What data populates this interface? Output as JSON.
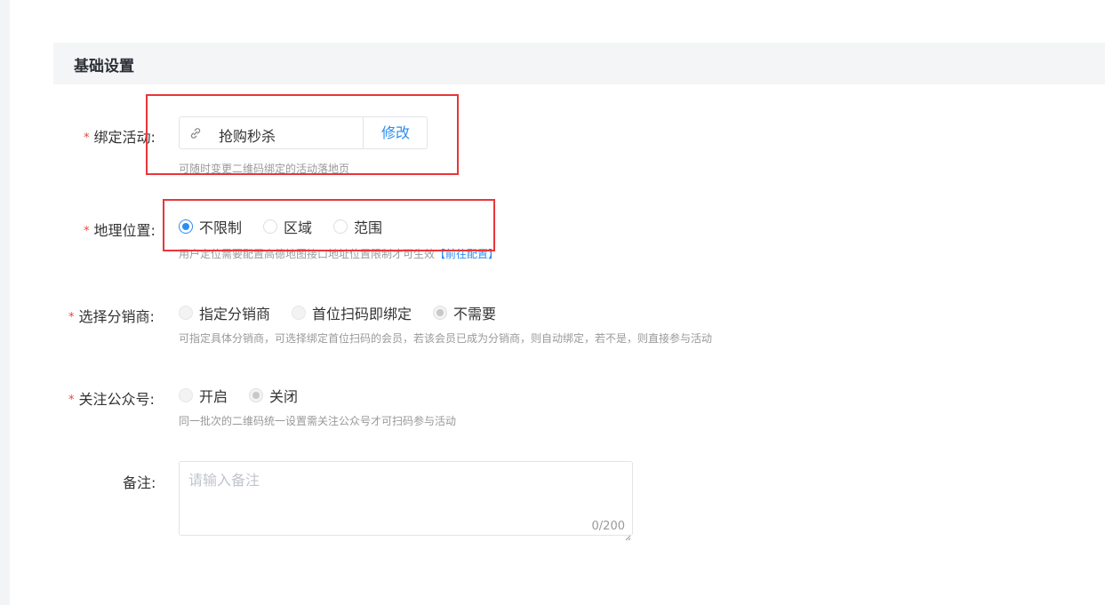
{
  "section": {
    "title": "基础设置"
  },
  "bind_activity": {
    "label": "绑定活动:",
    "value": "抢购秒杀",
    "action_label": "修改",
    "help": "可随时变更二维码绑定的活动落地页"
  },
  "geo": {
    "label": "地理位置:",
    "options": [
      "不限制",
      "区域",
      "范围"
    ],
    "selected": "不限制",
    "help": "用户定位需要配置高德地图接口地址位置限制才可生效",
    "help_link": "【前往配置】"
  },
  "distributor": {
    "label": "选择分销商:",
    "options": [
      "指定分销商",
      "首位扫码即绑定",
      "不需要"
    ],
    "selected": "不需要",
    "help": "可指定具体分销商，可选择绑定首位扫码的会员，若该会员已成为分销商，则自动绑定，若不是，则直接参与活动"
  },
  "follow_account": {
    "label": "关注公众号:",
    "options": [
      "开启",
      "关闭"
    ],
    "selected": "关闭",
    "help": "同一批次的二维码统一设置需关注公众号才可扫码参与活动"
  },
  "remark": {
    "label": "备注:",
    "placeholder": "请输入备注",
    "count": "0/200"
  },
  "required_mark": "*",
  "colors": {
    "accent": "#2d8cf0",
    "required": "#e8473a",
    "annotation": "#e8363b"
  }
}
